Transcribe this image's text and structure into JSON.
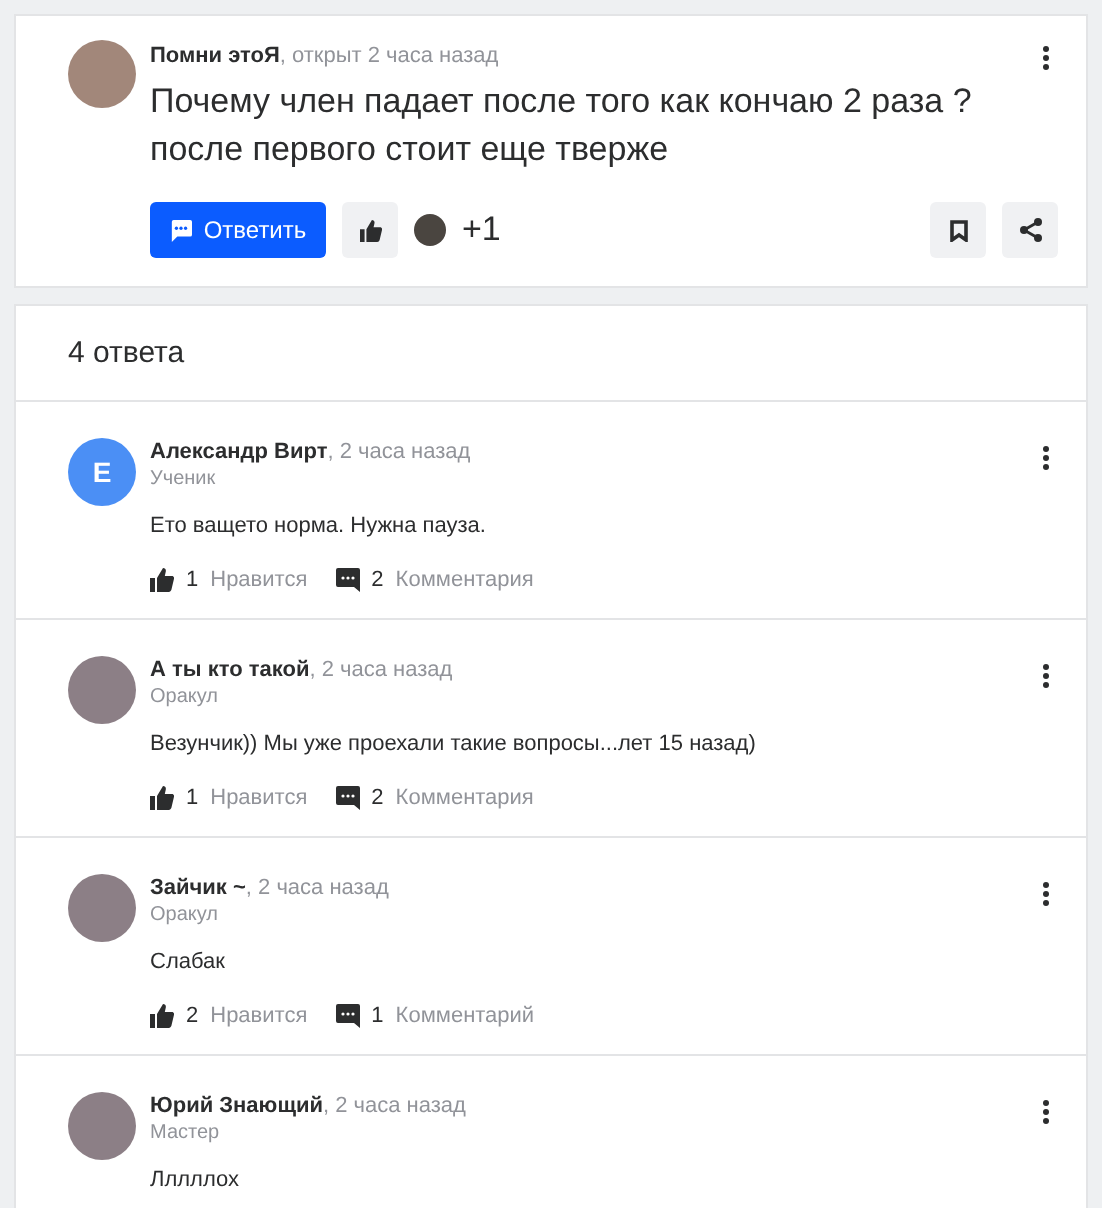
{
  "question": {
    "author": "Помни этоЯ",
    "meta": ", открыт 2 часа назад",
    "title": "Почему член падает после того как кончаю 2 раза ?после первого стоит еще тверже",
    "reply_button": "Ответить",
    "likers_count": "+1"
  },
  "answers_header": "4 ответа",
  "answers": [
    {
      "author": "Александр Вирт",
      "time": ", 2 часа назад",
      "rank": "Ученик",
      "avatar": {
        "kind": "letter",
        "letter": "Е"
      },
      "text": "Ето ващето норма. Нужна пауза.",
      "likes": "1",
      "likes_label": "Нравится",
      "comments": "2",
      "comments_label": "Комментария"
    },
    {
      "author": "А ты кто такой",
      "time": ", 2 часа назад",
      "rank": "Оракул",
      "avatar": {
        "kind": "photo"
      },
      "text": "Везунчик)) Мы уже проехали такие вопросы...лет 15 назад)",
      "likes": "1",
      "likes_label": "Нравится",
      "comments": "2",
      "comments_label": "Комментария"
    },
    {
      "author": "Зайчик ~",
      "time": ", 2 часа назад",
      "rank": "Оракул",
      "avatar": {
        "kind": "photo"
      },
      "text": "Слабак",
      "likes": "2",
      "likes_label": "Нравится",
      "comments": "1",
      "comments_label": "Комментарий"
    },
    {
      "author": "Юрий Знающий",
      "time": ", 2 часа назад",
      "rank": "Мастер",
      "avatar": {
        "kind": "photo"
      },
      "text": "Лллллох"
    }
  ]
}
